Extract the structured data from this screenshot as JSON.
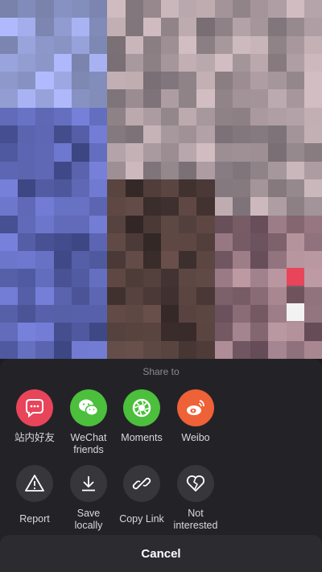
{
  "share_sheet": {
    "title": "Share to",
    "share_targets": [
      {
        "label": "站内好友",
        "icon": "chat-bubble-icon",
        "color": "#e8455a"
      },
      {
        "label": "WeChat\nfriends",
        "icon": "wechat-icon",
        "color": "#4cbf3c"
      },
      {
        "label": "Moments",
        "icon": "moments-icon",
        "color": "#4cbf3c"
      },
      {
        "label": "Weibo",
        "icon": "weibo-icon",
        "color": "#ef6137"
      }
    ],
    "actions": [
      {
        "label": "Report",
        "icon": "warning-icon"
      },
      {
        "label": "Save\nlocally",
        "icon": "download-icon"
      },
      {
        "label": "Copy Link",
        "icon": "link-icon"
      },
      {
        "label": "Not\ninterested",
        "icon": "broken-heart-icon"
      }
    ],
    "cancel_label": "Cancel"
  },
  "colors": {
    "sheet_background": "#232327",
    "action_icon_background": "#36363b",
    "side_marker_red": "#e8455a",
    "side_marker_white": "#f2f2f2"
  }
}
